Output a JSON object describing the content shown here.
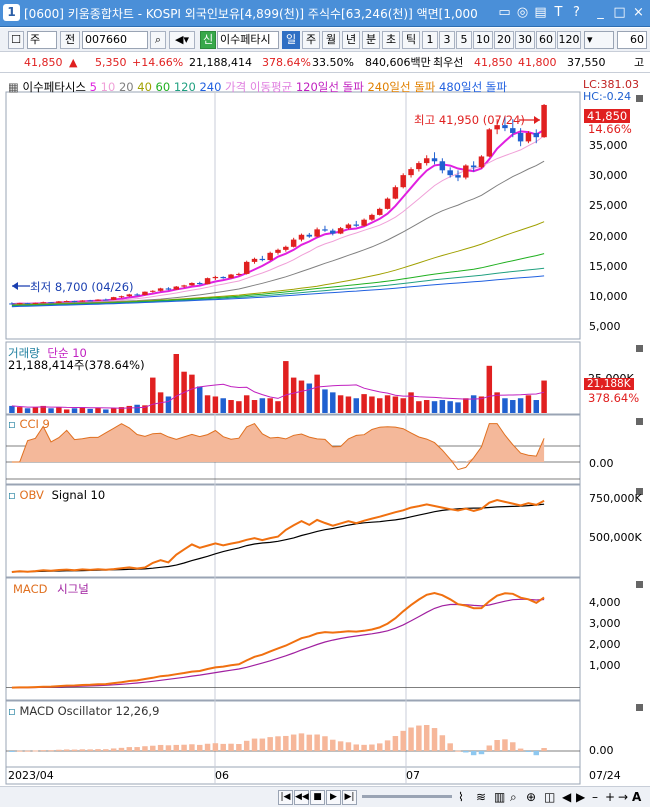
{
  "window": {
    "num": "1",
    "title": "[0600] 키움종합차트 - KOSPI 외국인보유[4,899(천)] 주식수[63,246(천)] 액면[1,000",
    "controls": [
      "▭",
      "◎",
      "▤",
      "T",
      "?",
      "_",
      "□",
      "×"
    ]
  },
  "toolbar": {
    "market": "주",
    "prev_label": "전",
    "code": "007660",
    "name_badge": "신",
    "name": "이수페타시",
    "periods": [
      "일",
      "주",
      "월",
      "년",
      "분",
      "초",
      "틱"
    ],
    "selected_period": "일",
    "intervals": [
      "1",
      "3",
      "5",
      "10",
      "20",
      "30",
      "60",
      "120"
    ],
    "count": "60"
  },
  "info": {
    "price": "41,850",
    "arrow": "▲",
    "change": "5,350",
    "change_pct": "+14.66%",
    "volume": "21,188,414",
    "volume_pct": "378.64%",
    "turnover": "33.50%",
    "amount": "840,606백만",
    "pref_label": "최우선",
    "best_ask": "41,850",
    "best_bid": "41,800",
    "limit": "37,550",
    "limit_label": "고"
  },
  "price_pane": {
    "legend_name": "이수페타시스",
    "ma_labels": [
      {
        "text": "5",
        "color": "#e020e0"
      },
      {
        "text": "10",
        "color": "#f0a0d8"
      },
      {
        "text": "20",
        "color": "#808080"
      },
      {
        "text": "40",
        "color": "#a0a000"
      },
      {
        "text": "60",
        "color": "#20b020"
      },
      {
        "text": "120",
        "color": "#20a080"
      },
      {
        "text": "240",
        "color": "#2060e0"
      }
    ],
    "extra_labels": [
      {
        "text": "가격 이동평균",
        "color": "#e080e0"
      },
      {
        "text": "120일선 돌파",
        "color": "#c020c0"
      },
      {
        "text": "240일선 돌파",
        "color": "#e08000"
      },
      {
        "text": "480일선 돌파",
        "color": "#2060e0"
      }
    ],
    "lc": "LC:381.03",
    "hc": "HC:-0.24",
    "high_note": "최고 41,950 (07/24)",
    "low_note": "최저 8,700 (04/26)",
    "price_tag": "41,850",
    "pct_tag": "14.66%",
    "yticks": [
      "35,000",
      "30,000",
      "25,000",
      "20,000",
      "15,000",
      "10,000",
      "5,000"
    ]
  },
  "volume_pane": {
    "title": "거래량",
    "ma": "단순 10",
    "value": "21,188,414주(378.64%)",
    "ytick": "25,000K",
    "tag": "21,188K",
    "pct": "378.64%"
  },
  "cci_pane": {
    "title": "CCI 9",
    "ytick": "0.00"
  },
  "obv_pane": {
    "title": "OBV",
    "signal": "Signal 10",
    "yticks": [
      "750,000K",
      "500,000K"
    ]
  },
  "macd_pane": {
    "title": "MACD",
    "signal": "시그널",
    "yticks": [
      "4,000",
      "3,000",
      "2,000",
      "1,000"
    ]
  },
  "osc_pane": {
    "title": "MACD Oscillator 12,26,9",
    "ytick": "0.00"
  },
  "xaxis": {
    "labels": [
      "2023/04",
      "06",
      "07",
      "07/24"
    ]
  },
  "colors": {
    "up": "#e02020",
    "down": "#2060d0",
    "ma5": "#e020e0",
    "orange": "#f07010"
  },
  "chart_data": {
    "type": "candlestick",
    "ohlc": [
      [
        8900,
        9100,
        8700,
        8800
      ],
      [
        8800,
        9000,
        8750,
        8950
      ],
      [
        8950,
        9000,
        8800,
        8850
      ],
      [
        8850,
        9050,
        8800,
        9000
      ],
      [
        9000,
        9200,
        8950,
        9100
      ],
      [
        9100,
        9150,
        8950,
        9000
      ],
      [
        9000,
        9300,
        8980,
        9250
      ],
      [
        9250,
        9400,
        9150,
        9300
      ],
      [
        9300,
        9350,
        9100,
        9200
      ],
      [
        9200,
        9450,
        9180,
        9400
      ],
      [
        9400,
        9500,
        9300,
        9350
      ],
      [
        9350,
        9600,
        9300,
        9550
      ],
      [
        9550,
        9700,
        9450,
        9500
      ],
      [
        9500,
        10000,
        9480,
        9950
      ],
      [
        9950,
        10200,
        9800,
        10100
      ],
      [
        10100,
        10500,
        10000,
        10400
      ],
      [
        10400,
        10600,
        10200,
        10300
      ],
      [
        10300,
        10900,
        10250,
        10850
      ],
      [
        10850,
        11100,
        10700,
        11000
      ],
      [
        11000,
        11500,
        10900,
        11400
      ],
      [
        11400,
        11600,
        11100,
        11200
      ],
      [
        11200,
        11800,
        11150,
        11700
      ],
      [
        11700,
        12000,
        11500,
        11900
      ],
      [
        11900,
        12400,
        11850,
        12300
      ],
      [
        12300,
        12500,
        12000,
        12100
      ],
      [
        12100,
        13200,
        12050,
        13100
      ],
      [
        13100,
        13500,
        12800,
        13300
      ],
      [
        13300,
        13400,
        13000,
        13100
      ],
      [
        13100,
        13800,
        13050,
        13700
      ],
      [
        13700,
        14000,
        13500,
        13800
      ],
      [
        13800,
        16000,
        13700,
        15800
      ],
      [
        15800,
        16500,
        15500,
        16300
      ],
      [
        16300,
        16800,
        15900,
        16100
      ],
      [
        16100,
        17500,
        16000,
        17300
      ],
      [
        17300,
        18000,
        17000,
        17800
      ],
      [
        17800,
        18500,
        17500,
        18300
      ],
      [
        18300,
        19800,
        18200,
        19500
      ],
      [
        19500,
        20500,
        19200,
        20300
      ],
      [
        20300,
        20600,
        19800,
        20000
      ],
      [
        20000,
        21500,
        19900,
        21200
      ],
      [
        21200,
        21800,
        20800,
        21000
      ],
      [
        21000,
        21300,
        20200,
        20500
      ],
      [
        20500,
        21600,
        20400,
        21400
      ],
      [
        21400,
        22200,
        21200,
        22000
      ],
      [
        22000,
        22600,
        21600,
        21800
      ],
      [
        21800,
        23000,
        21700,
        22800
      ],
      [
        22800,
        23800,
        22600,
        23600
      ],
      [
        23600,
        24800,
        23500,
        24600
      ],
      [
        24600,
        26500,
        24500,
        26300
      ],
      [
        26300,
        28500,
        26200,
        28200
      ],
      [
        28200,
        30500,
        28000,
        30200
      ],
      [
        30200,
        31500,
        29800,
        31200
      ],
      [
        31200,
        32500,
        30800,
        32200
      ],
      [
        32200,
        33500,
        31800,
        33000
      ],
      [
        33000,
        34000,
        32000,
        32500
      ],
      [
        32500,
        33000,
        30500,
        31000
      ],
      [
        31000,
        31500,
        29800,
        30200
      ],
      [
        30200,
        31000,
        29200,
        29800
      ],
      [
        29800,
        32000,
        29500,
        31800
      ],
      [
        31800,
        32500,
        30800,
        31500
      ],
      [
        31500,
        33500,
        31300,
        33300
      ],
      [
        33300,
        38000,
        33200,
        37800
      ],
      [
        37800,
        39500,
        37000,
        38500
      ],
      [
        38500,
        40000,
        37500,
        38000
      ],
      [
        38000,
        39500,
        36500,
        37200
      ],
      [
        37200,
        38000,
        35000,
        35800
      ],
      [
        35800,
        37500,
        35500,
        37200
      ],
      [
        37200,
        37800,
        35500,
        36500
      ],
      [
        36500,
        42000,
        36400,
        41850
      ]
    ],
    "volume_rel": [
      0.12,
      0.1,
      0.08,
      0.1,
      0.12,
      0.08,
      0.1,
      0.06,
      0.08,
      0.1,
      0.07,
      0.09,
      0.06,
      0.08,
      0.1,
      0.12,
      0.14,
      0.13,
      0.6,
      0.35,
      0.28,
      1.0,
      0.7,
      0.65,
      0.45,
      0.3,
      0.28,
      0.25,
      0.22,
      0.2,
      0.3,
      0.22,
      0.25,
      0.25,
      0.2,
      0.88,
      0.6,
      0.55,
      0.5,
      0.65,
      0.4,
      0.35,
      0.3,
      0.28,
      0.25,
      0.32,
      0.28,
      0.25,
      0.3,
      0.28,
      0.25,
      0.35,
      0.2,
      0.22,
      0.2,
      0.22,
      0.2,
      0.18,
      0.25,
      0.3,
      0.28,
      0.8,
      0.35,
      0.25,
      0.22,
      0.25,
      0.3,
      0.22,
      0.55
    ],
    "xticks": [
      "2023/04",
      "06",
      "07",
      "07/24"
    ]
  }
}
